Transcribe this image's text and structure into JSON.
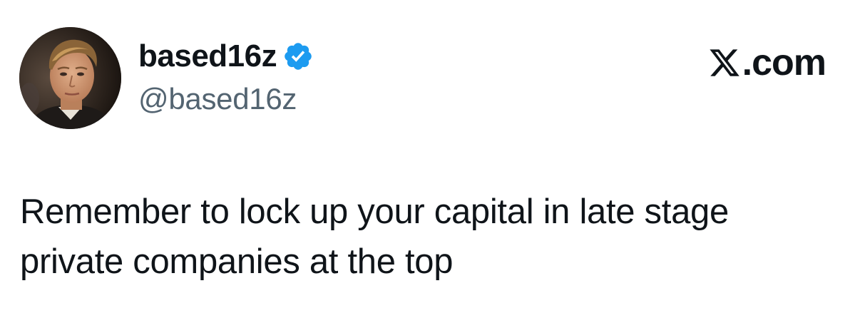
{
  "author": {
    "display_name": "based16z",
    "handle": "@based16z",
    "verified_icon": "verified-badge-icon",
    "avatar_icon": "avatar"
  },
  "brand": {
    "logo_icon": "x-logo-icon",
    "text": ".com"
  },
  "tweet": {
    "text": "Remember to lock up your capital in late stage\nprivate companies at the top"
  },
  "colors": {
    "verified_blue": "#1d9bf0",
    "text_primary": "#0f1419",
    "text_secondary": "#536471",
    "background": "#ffffff"
  }
}
